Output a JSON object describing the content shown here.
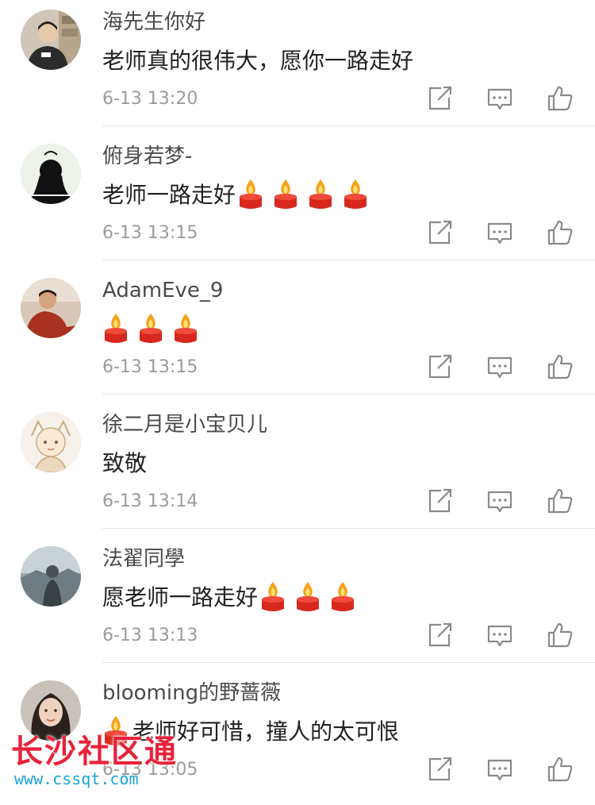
{
  "comments": [
    {
      "user": "海先生你好",
      "text": "老师真的很伟大，愿你一路走好",
      "time": "6-13 13:20",
      "candles_after": 0,
      "candles_before": 0,
      "avatar": "man-in-room"
    },
    {
      "user": "俯身若梦-",
      "text": "老师一路走好",
      "time": "6-13 13:15",
      "candles_after": 4,
      "candles_before": 0,
      "avatar": "silhouette"
    },
    {
      "user": "AdamEve_9",
      "text": "",
      "time": "6-13 13:15",
      "candles_after": 3,
      "candles_before": 0,
      "avatar": "boy-red-shirt"
    },
    {
      "user": "徐二月是小宝贝儿",
      "text": "致敬",
      "time": "6-13 13:14",
      "candles_after": 0,
      "candles_before": 0,
      "avatar": "anime-sketch"
    },
    {
      "user": "法翟同學",
      "text": "愿老师一路走好",
      "time": "6-13 13:13",
      "candles_after": 3,
      "candles_before": 0,
      "avatar": "person-landscape"
    },
    {
      "user": "blooming的野蔷薇",
      "text": "老师好可惜，撞人的太可恨",
      "time": "6-13 13:05",
      "candles_after": 0,
      "candles_before": 1,
      "avatar": "woman-portrait"
    }
  ],
  "actions": {
    "share_icon": "share-icon",
    "reply_icon": "comment-icon",
    "like_icon": "thumbs-up-icon"
  },
  "emoji": "candle",
  "watermark": {
    "title": "长沙社区通",
    "url": "www.cssqt.com"
  },
  "colors": {
    "username": "#4a4a4a",
    "text": "#222222",
    "time": "#9b9b9b",
    "divider": "#e5e5e5",
    "icon": "#8a8a8a",
    "watermark_red": "#e8233a",
    "watermark_blue": "#1aa3d9"
  }
}
